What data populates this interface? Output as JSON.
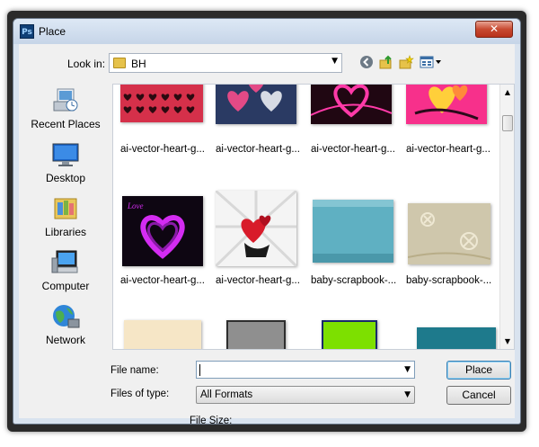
{
  "window": {
    "title": "Place",
    "app_icon": "Ps",
    "close_label": "x"
  },
  "lookin": {
    "label": "Look in:",
    "value": "BH"
  },
  "toolbar": {
    "back_icon": "back-icon",
    "up_icon": "up-folder-icon",
    "new_icon": "new-folder-icon",
    "views_icon": "views-menu-icon"
  },
  "places": [
    {
      "label": "Recent Places",
      "icon": "recent-places-icon"
    },
    {
      "label": "Desktop",
      "icon": "desktop-icon"
    },
    {
      "label": "Libraries",
      "icon": "libraries-icon"
    },
    {
      "label": "Computer",
      "icon": "computer-icon"
    },
    {
      "label": "Network",
      "icon": "network-icon"
    }
  ],
  "files": [
    {
      "label": "ai-vector-heart-g..."
    },
    {
      "label": "ai-vector-heart-g..."
    },
    {
      "label": "ai-vector-heart-g..."
    },
    {
      "label": "ai-vector-heart-g..."
    },
    {
      "label": "ai-vector-heart-g..."
    },
    {
      "label": "ai-vector-heart-g..."
    },
    {
      "label": "baby-scrapbook-..."
    },
    {
      "label": "baby-scrapbook-..."
    }
  ],
  "filename": {
    "label": "File name:",
    "value": ""
  },
  "filetype": {
    "label": "Files of type:",
    "value": "All Formats"
  },
  "filesize": {
    "label": "File Size:"
  },
  "buttons": {
    "place": "Place",
    "cancel": "Cancel"
  },
  "colors": {
    "accent": "#3c7fb1",
    "heart_pink": "#e0207a",
    "heart_purple": "#b01ed0"
  }
}
